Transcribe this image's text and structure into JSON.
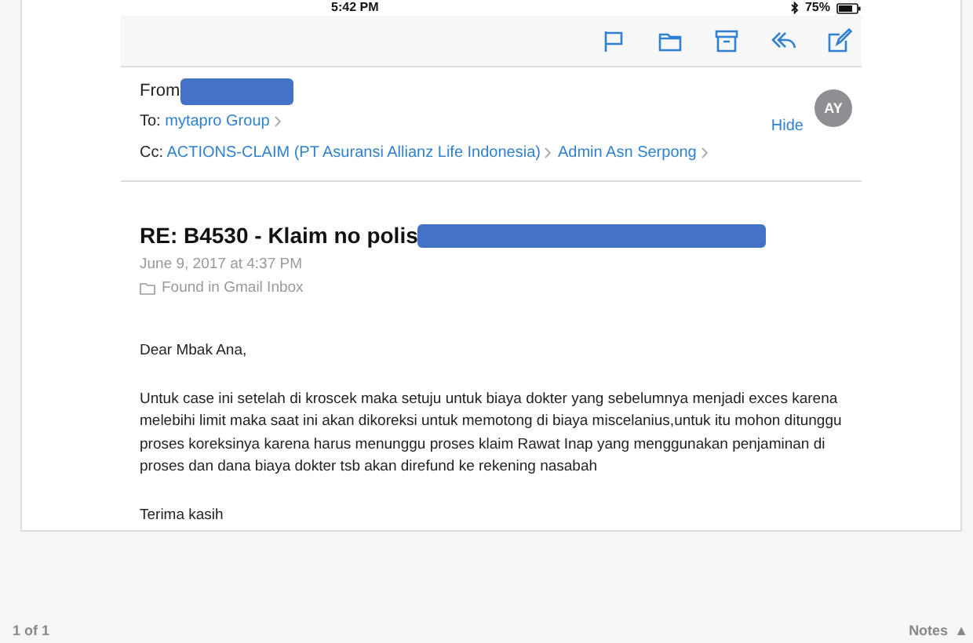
{
  "status_bar": {
    "time": "5:42 PM",
    "battery": "75%"
  },
  "message": {
    "from_label": "From",
    "to_label": "To:",
    "to": [
      {
        "name": "mytapro Group"
      }
    ],
    "cc_label": "Cc:",
    "cc": [
      {
        "name": "ACTIONS-CLAIM (PT Asuransi Allianz Life Indonesia)"
      },
      {
        "name": "Admin Asn Serpong"
      }
    ],
    "hide": "Hide",
    "avatar": "AY",
    "subject": "RE: B4530 - Klaim no polis",
    "date": "June 9, 2017 at 4:37 PM",
    "folder": "Found in Gmail Inbox",
    "body": [
      "Dear Mbak Ana,",
      "Untuk case ini setelah di kroscek maka setuju untuk biaya dokter yang sebelumnya menjadi exces karena melebihi limit maka saat ini akan dikoreksi untuk memotong di biaya miscelanius,untuk itu mohon ditunggu proses koreksinya karena harus menunggu proses klaim Rawat Inap yang menggunakan penjaminan di proses dan dana  biaya dokter tsb akan direfund ke rekening nasabah",
      "Terima kasih"
    ]
  },
  "footer": {
    "page": "1 of 1",
    "notes": "Notes",
    "notes_arrow": "▲"
  }
}
